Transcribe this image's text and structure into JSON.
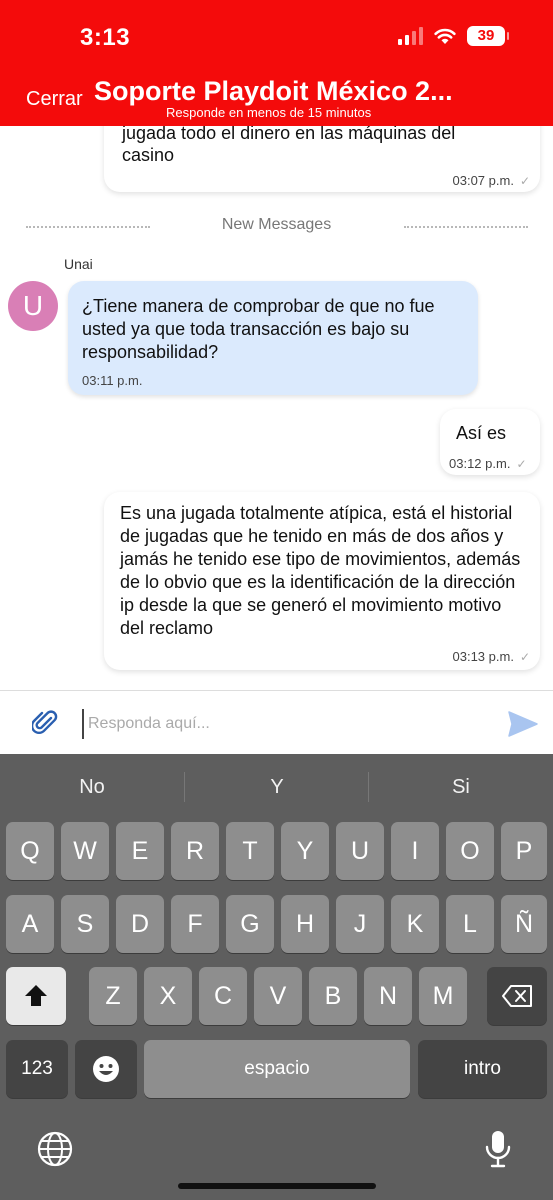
{
  "status": {
    "time": "3:13",
    "battery": "39"
  },
  "header": {
    "close_label": "Cerrar",
    "title": "Soporte Playdoit México 2...",
    "subtitle": "Responde en menos de 15 minutos"
  },
  "chat": {
    "messages": [
      {
        "direction": "out",
        "text_cut": "jugada todo el dinero en las  máquinas del",
        "text": "casino",
        "time": "03:07 p.m."
      },
      {
        "direction": "in",
        "sender": "Unai",
        "avatar_letter": "U",
        "text": "¿Tiene manera de comprobar de que no fue usted ya que toda transacción es bajo su responsabilidad?",
        "time": "03:11 p.m."
      },
      {
        "direction": "out",
        "text": "Así es",
        "time": "03:12 p.m."
      },
      {
        "direction": "out",
        "text": "Es una jugada totalmente atípica, está el historial de jugadas que he tenido en más de dos años y jamás he tenido ese tipo de movimientos, además de lo obvio que es la identificación de la dirección ip desde la que se generó el movimiento motivo del reclamo",
        "time": "03:13 p.m."
      }
    ],
    "new_messages_label": "New Messages"
  },
  "input": {
    "placeholder": "Responda aquí..."
  },
  "keyboard": {
    "suggestions": [
      "No",
      "Y",
      "Si"
    ],
    "row1": [
      "Q",
      "W",
      "E",
      "R",
      "T",
      "Y",
      "U",
      "I",
      "O",
      "P"
    ],
    "row2": [
      "A",
      "S",
      "D",
      "F",
      "G",
      "H",
      "J",
      "K",
      "L",
      "Ñ"
    ],
    "row3": [
      "Z",
      "X",
      "C",
      "V",
      "B",
      "N",
      "M"
    ],
    "numbers_label": "123",
    "space_label": "espacio",
    "return_label": "intro"
  },
  "colors": {
    "header": "#f40b0b",
    "incoming_bubble": "#dbeafd",
    "avatar": "#d97fb6",
    "send_icon": "#a9c5f0"
  }
}
